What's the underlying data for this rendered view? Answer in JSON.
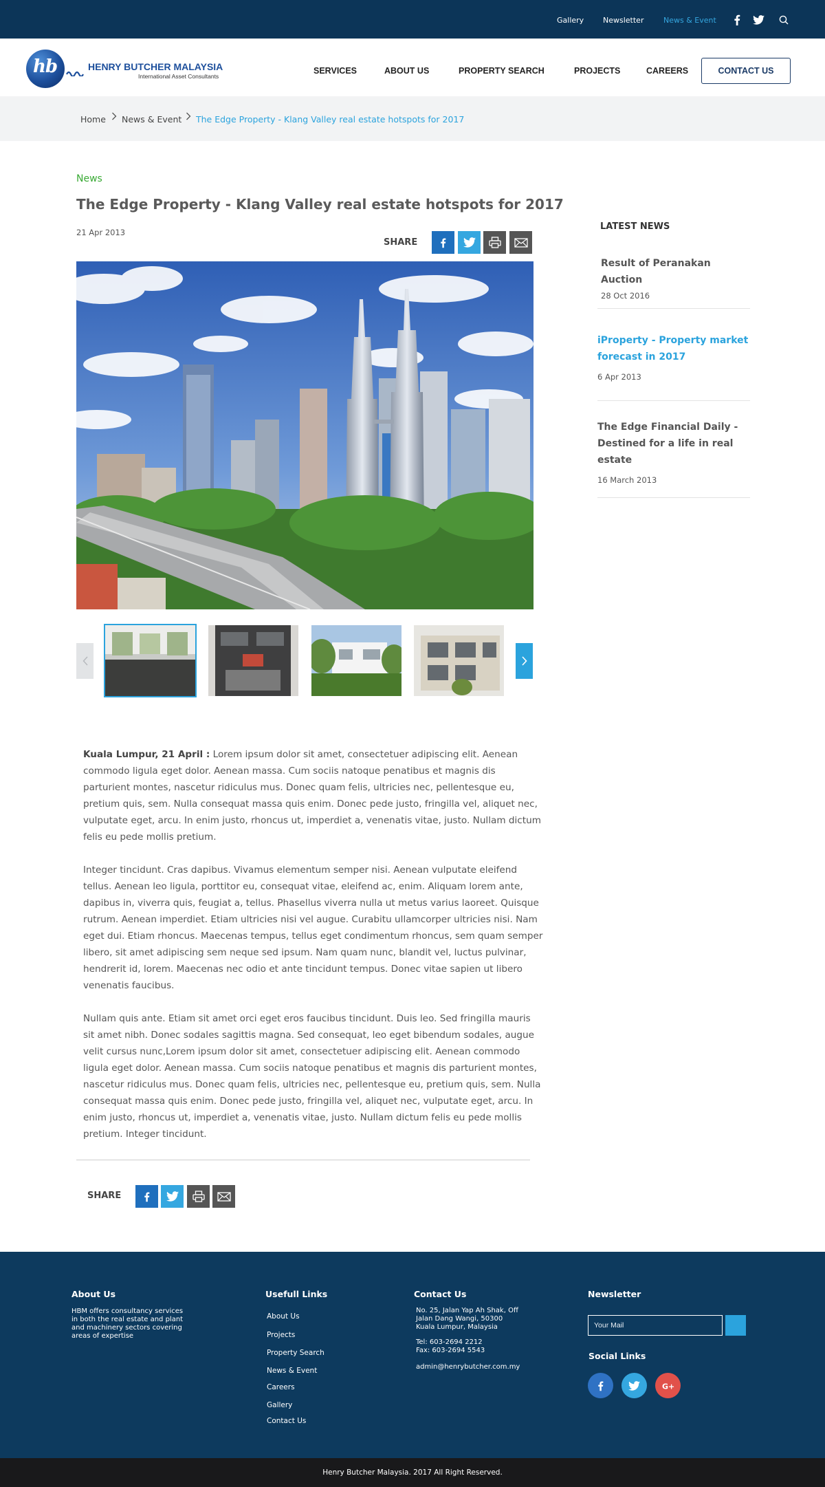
{
  "topbar": {
    "links": [
      "Gallery",
      "Newsletter",
      "News & Event"
    ],
    "icons": [
      "facebook-icon",
      "twitter-icon",
      "search-icon"
    ]
  },
  "logo": {
    "mark": "hb",
    "name": "HENRY BUTCHER MALAYSIA",
    "tagline": "International Asset Consultants"
  },
  "nav": {
    "items": [
      "SERVICES",
      "ABOUT US",
      "PROPERTY SEARCH",
      "PROJECTS",
      "CAREERS"
    ],
    "contact": "CONTACT US"
  },
  "breadcrumb": {
    "items": [
      "Home",
      "News & Event",
      "The Edge Property - Klang Valley real estate hotspots for 2017"
    ]
  },
  "article": {
    "category": "News",
    "title": "The Edge Property - Klang Valley real estate hotspots for 2017",
    "date": "21 Apr 2013",
    "share_label": "SHARE",
    "lead": "Kuala Lumpur, 21 April :",
    "paragraphs": [
      " Lorem ipsum dolor sit amet, consectetuer adipiscing elit. Aenean commodo ligula eget dolor. Aenean  massa. Cum sociis natoque penatibus et magnis dis parturient montes, nascetur ridiculus mus. Donec quam felis, ultricies nec, pellentesque eu, pretium quis, sem. Nulla consequat massa quis enim. Donec pede justo, fringilla vel, aliquet nec, vulputate eget, arcu. In enim justo, rhoncus ut, imperdiet a, venenatis vitae, justo. Nullam dictum felis eu pede mollis pretium.",
      "Integer tincidunt. Cras dapibus. Vivamus elementum semper nisi. Aenean vulputate eleifend tellus. Aenean leo ligula, porttitor eu, consequat vitae, eleifend ac, enim. Aliquam lorem ante, dapibus in, viverra quis, feugiat a, tellus. Phasellus viverra nulla ut metus varius laoreet. Quisque rutrum. Aenean imperdiet. Etiam ultricies nisi vel augue. Curabitu ullamcorper ultricies nisi. Nam eget dui. Etiam rhoncus. Maecenas tempus, tellus eget condimentum rhoncus, sem quam semper libero, sit amet adipiscing sem neque sed ipsum. Nam quam nunc, blandit vel, luctus pulvinar, hendrerit id, lorem. Maecenas nec odio et ante tincidunt tempus. Donec vitae sapien ut libero venenatis faucibus.",
      "Nullam quis ante. Etiam sit amet orci eget eros faucibus tincidunt. Duis leo. Sed fringilla mauris sit amet nibh. Donec sodales sagittis magna. Sed consequat, leo eget bibendum sodales, augue velit cursus nunc,Lorem ipsum dolor sit amet, consectetuer adipiscing elit. Aenean commodo ligula eget dolor. Aenean massa. Cum sociis natoque penatibus et magnis dis parturient montes, nascetur ridiculus mus. Donec quam felis, ultricies nec, pellentesque eu, pretium quis, sem. Nulla consequat massa quis enim. Donec pede justo, fringilla vel, aliquet nec, vulputate eget, arcu. In enim justo, rhoncus ut, imperdiet a, venenatis vitae, justo. Nullam dictum felis eu pede mollis pretium. Integer tincidunt."
    ]
  },
  "sidebar": {
    "title": "LATEST NEWS",
    "items": [
      {
        "title": "Result of Peranakan Auction",
        "date": "28 Oct 2016"
      },
      {
        "title": "iProperty - Property market forecast in 2017",
        "date": "6 Apr 2013"
      },
      {
        "title": "The Edge Financial Daily - Destined for a life in real estate",
        "date": "16 March 2013"
      }
    ]
  },
  "footer": {
    "about": {
      "heading": "About Us",
      "text": "HBM offers consultancy services in both the real estate and plant and machinery sectors covering areas of expertise"
    },
    "links": {
      "heading": "Usefull Links",
      "items": [
        "About Us",
        "Projects",
        "Property Search",
        "News & Event",
        "Careers",
        "Gallery",
        "Contact Us"
      ]
    },
    "contact": {
      "heading": "Contact Us",
      "address": [
        "No. 25, Jalan Yap Ah Shak, Off",
        "Jalan Dang Wangi, 50300",
        "Kuala Lumpur, Malaysia"
      ],
      "tel": "Tel: 603-2694 2212",
      "fax": "Fax: 603-2694 5543",
      "email": "admin@henrybutcher.com.my"
    },
    "newsletter": {
      "heading": "Newsletter",
      "placeholder": "Your Mail",
      "social_heading": "Social Links"
    },
    "copyright": "Henry Butcher Malaysia. 2017 All Right Reserved."
  },
  "colors": {
    "navy": "#0c3558",
    "accent": "#2ba3dd",
    "news_green": "#3aaa35",
    "google_red": "#e1514a"
  }
}
